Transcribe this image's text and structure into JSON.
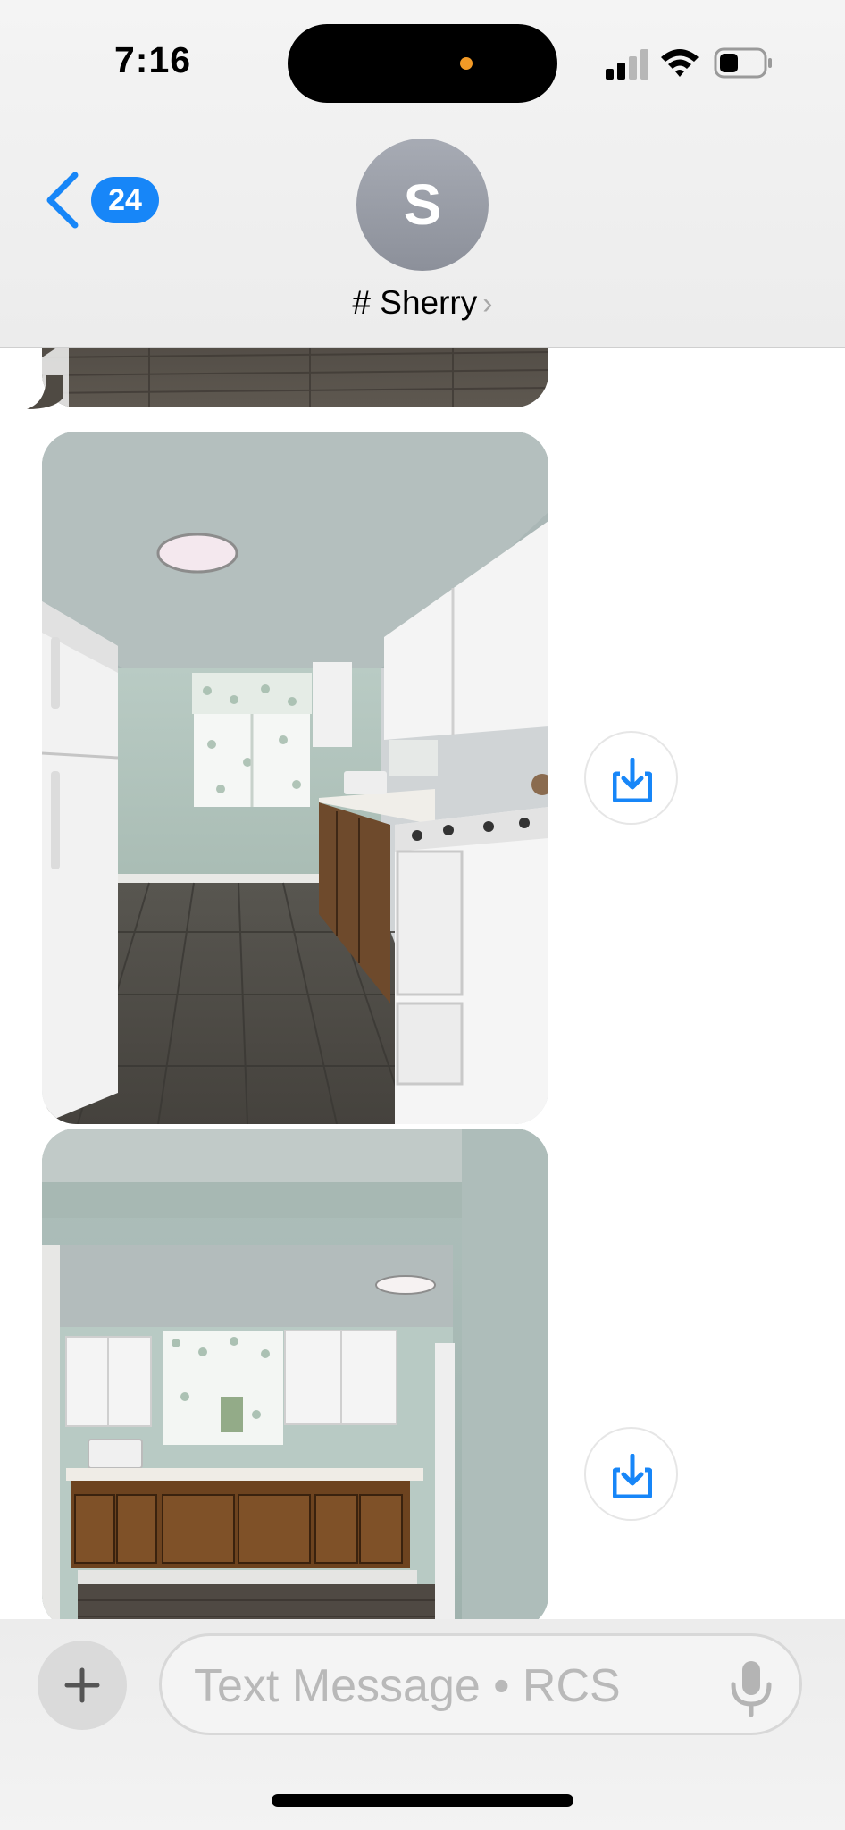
{
  "status_bar": {
    "time": "7:16",
    "signal_icon": "cellular-signal-icon",
    "wifi_icon": "wifi-icon",
    "battery_icon": "battery-icon",
    "battery_level": 0.3,
    "recording_indicator_color": "#f39a26"
  },
  "header": {
    "back_icon": "chevron-left-icon",
    "unread_count": "24",
    "avatar_initial": "S",
    "contact_name": "# Sherry",
    "name_chevron": "›"
  },
  "messages": [
    {
      "type": "photo",
      "content": "kitchen-photo-partial",
      "description_icon": "image"
    },
    {
      "type": "photo",
      "content": "galley-kitchen-photo",
      "save_icon": "save-to-photos-icon"
    },
    {
      "type": "photo",
      "content": "kitchen-sink-cabinets-photo",
      "save_icon": "save-to-photos-icon"
    }
  ],
  "composer": {
    "plus_icon": "plus-icon",
    "placeholder": "Text Message • RCS",
    "mic_icon": "microphone-icon"
  },
  "colors": {
    "accent": "#1786f8",
    "header_bg": "#efefef",
    "avatar": "#9a9ea8",
    "placeholder": "#b9b9b9"
  }
}
